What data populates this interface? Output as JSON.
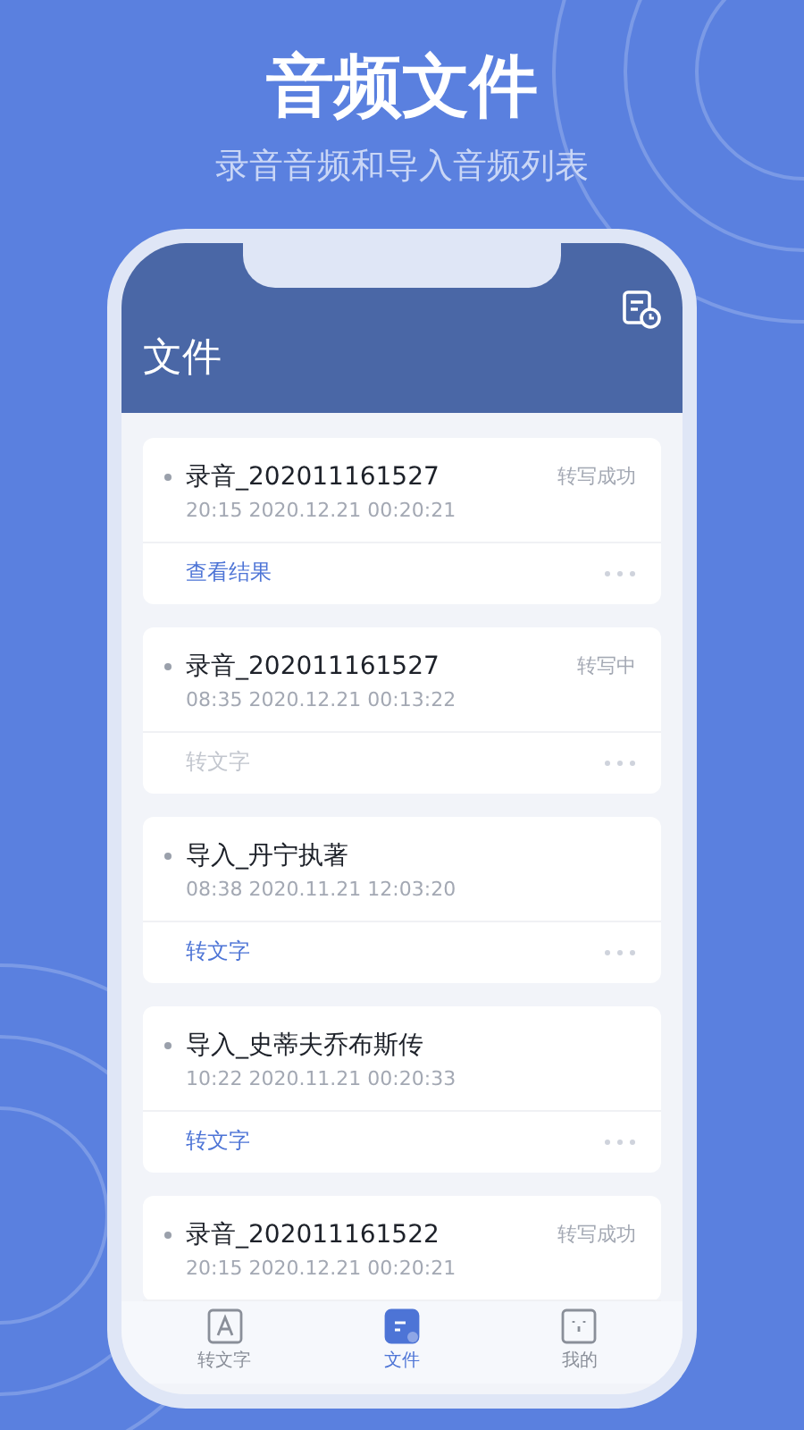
{
  "headline": "音频文件",
  "subtitle": "录音音频和导入音频列表",
  "screen": {
    "title": "文件",
    "files": [
      {
        "name": "录音_202011161527",
        "meta": "20:15 2020.12.21 00:20:21",
        "status": "转写成功",
        "action": {
          "label": "查看结果",
          "disabled": false
        }
      },
      {
        "name": "录音_202011161527",
        "meta": "08:35 2020.12.21 00:13:22",
        "status": "转写中",
        "action": {
          "label": "转文字",
          "disabled": true
        }
      },
      {
        "name": "导入_丹宁执著",
        "meta": "08:38 2020.11.21 12:03:20",
        "action": {
          "label": "转文字",
          "disabled": false
        }
      },
      {
        "name": "导入_史蒂夫乔布斯传",
        "meta": "10:22 2020.11.21 00:20:33",
        "action": {
          "label": "转文字",
          "disabled": false
        }
      },
      {
        "name": "录音_202011161522",
        "meta": "20:15 2020.12.21 00:20:21",
        "status": "转写成功"
      }
    ],
    "tabs": [
      {
        "label": "转文字",
        "kind": "text",
        "selected": false
      },
      {
        "label": "文件",
        "kind": "file",
        "selected": true
      },
      {
        "label": "我的",
        "kind": "face",
        "selected": false
      }
    ]
  }
}
